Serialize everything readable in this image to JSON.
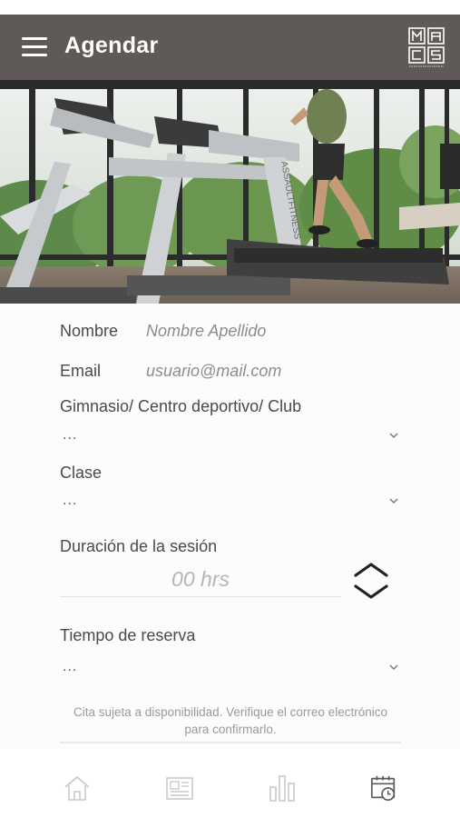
{
  "header": {
    "title": "Agendar",
    "icons": {
      "menu": "hamburger-menu-icon",
      "logo": "maces-logo"
    }
  },
  "hero": {
    "subject": "treadmill-gym-photo"
  },
  "form": {
    "nombre": {
      "label": "Nombre",
      "placeholder": "Nombre Apellido"
    },
    "email": {
      "label": "Email",
      "placeholder": "usuario@mail.com"
    },
    "gimnasio": {
      "label": "Gimnasio/ Centro deportivo/ Club",
      "value": "..."
    },
    "clase": {
      "label": "Clase",
      "value": "..."
    },
    "duracion": {
      "label": "Duración de la sesión",
      "value": "00 hrs"
    },
    "tiempo": {
      "label": "Tiempo de reserva",
      "value": "..."
    },
    "note": "Cita sujeta a disponibilidad. Verifique el correo electrónico para confirmarlo."
  },
  "tabbar": {
    "items": [
      {
        "icon": "home-icon"
      },
      {
        "icon": "newspaper-icon"
      },
      {
        "icon": "bar-chart-icon"
      },
      {
        "icon": "calendar-clock-icon",
        "active": true
      }
    ]
  },
  "colors": {
    "header_bg": "#5f5a58",
    "icon_gray": "#c9c9c9",
    "active_icon": "#5f5a58"
  }
}
